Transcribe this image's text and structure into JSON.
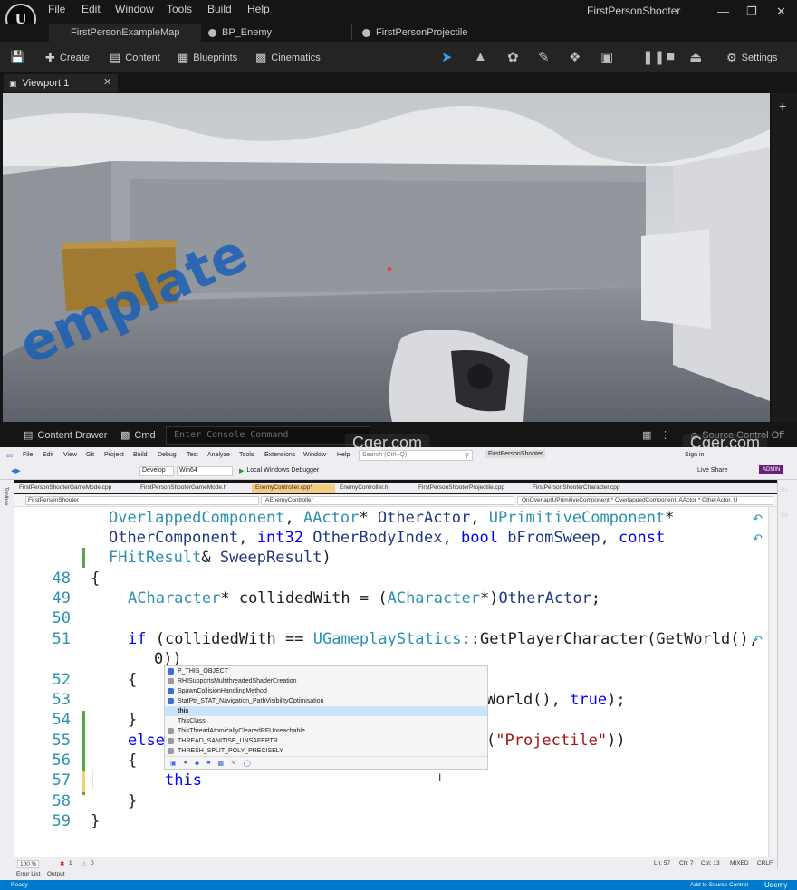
{
  "ue": {
    "logo": "U",
    "menu": [
      "File",
      "Edit",
      "Window",
      "Tools",
      "Build",
      "Help"
    ],
    "project_name": "FirstPersonShooter",
    "tabs": [
      "FirstPersonExampleMap",
      "BP_Enemy",
      "FirstPersonProjectile"
    ],
    "toolbar": {
      "create": "Create",
      "content": "Content",
      "blueprints": "Blueprints",
      "cinematics": "Cinematics",
      "settings": "Settings"
    },
    "viewport_tab": "Viewport 1",
    "viewport_text": "emplate",
    "bottom": {
      "content_drawer": "Content Drawer",
      "cmd": "Cmd",
      "cmd_placeholder": "Enter Console Command",
      "source_control": "Source Control Off"
    }
  },
  "watermarks": [
    "Cger.com",
    "Cger.com"
  ],
  "vs": {
    "menu": [
      "File",
      "Edit",
      "View",
      "Git",
      "Project",
      "Build",
      "Debug",
      "Test",
      "Analyze",
      "Tools",
      "Extensions",
      "Window",
      "Help"
    ],
    "search_placeholder": "Search (Ctrl+Q)",
    "solution": "FirstPersonShooter",
    "sign_in": "Sign in",
    "live_share": "Live Share",
    "admin": "ADMIN",
    "config": "Develop",
    "platform": "Win64",
    "debugger": "Local Windows Debugger",
    "doc_tabs": [
      "FirstPersonShooterGameMode.cpp",
      "FirstPersonShooterGameMode.h",
      "EnemyController.cpp*",
      "EnemyController.h",
      "FirstPersonShooterProjectile.cpp",
      "FirstPersonShooterCharacter.cpp"
    ],
    "nav": {
      "project": "FirstPersonShooter",
      "scope": "AEnemyController",
      "member": "OnOverlap(UPrimitiveComponent * OverlappedComponent, AActor * OtherActor, U"
    },
    "side_left": "Toolbox",
    "side_right": [
      "So",
      "Se"
    ],
    "autocomplete": [
      "P_THIS_OBJECT",
      "RHISupportsMultithreadedShaderCreation",
      "SpawnCollisionHandlingMethod",
      "StatPtr_STAT_Navigation_PathVisibilityOptimisation",
      "this",
      "ThisClass",
      "ThisThreadAtomicallyClearedRFUnreachable",
      "THREAD_SANITISE_UNSAFEPTR",
      "THRESH_SPLIT_POLY_PRECISELY"
    ],
    "status": {
      "zoom": "100 %",
      "errors": "1",
      "warnings": "0",
      "ln": "Ln: 57",
      "ch": "Ch: 7",
      "col": "Col: 13",
      "mixed": "MIXED",
      "crlf": "CRLF"
    },
    "error_list": "Error List",
    "output": "Output",
    "ready": "Ready",
    "add_source": "Add to Source Control",
    "udemy": "Udemy"
  },
  "code": {
    "line_numbers": [
      "48",
      "49",
      "50",
      "51",
      "52",
      "53",
      "54",
      "55",
      "56",
      "57",
      "58",
      "59"
    ]
  }
}
